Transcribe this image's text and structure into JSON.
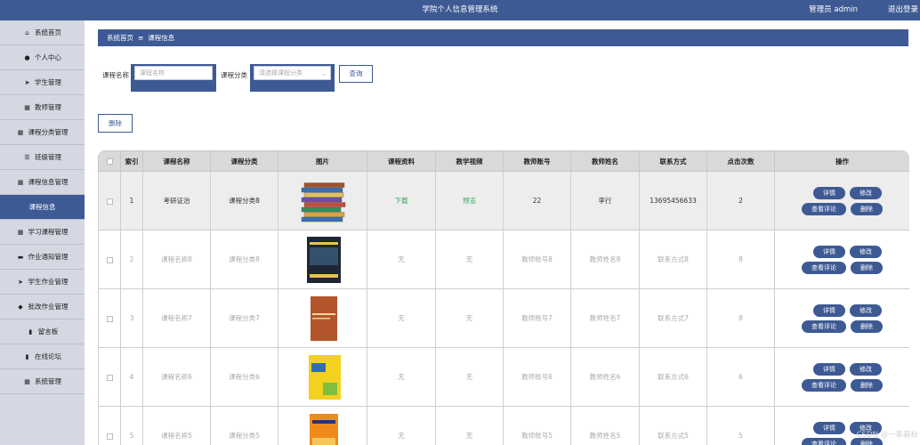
{
  "header": {
    "title": "学院个人信息管理系统",
    "user": "管理员 admin",
    "logout": "退出登录"
  },
  "sidebar": {
    "items": [
      {
        "label": "系统首页",
        "icon": "home-icon",
        "glyph": "⌂"
      },
      {
        "label": "个人中心",
        "icon": "person-icon",
        "glyph": "●"
      },
      {
        "label": "学生管理",
        "icon": "send-icon",
        "glyph": "➤"
      },
      {
        "label": "教师管理",
        "icon": "grid-icon",
        "glyph": "▦"
      },
      {
        "label": "课程分类管理",
        "icon": "grid-icon",
        "glyph": "▦"
      },
      {
        "label": "班级管理",
        "icon": "list-icon",
        "glyph": "☰"
      },
      {
        "label": "课程信息管理",
        "icon": "grid-icon",
        "glyph": "▦"
      },
      {
        "label": "课程信息",
        "icon": "",
        "glyph": ""
      },
      {
        "label": "学习课程管理",
        "icon": "grid-icon",
        "glyph": "▦"
      },
      {
        "label": "作业通知管理",
        "icon": "monitor-icon",
        "glyph": "▬"
      },
      {
        "label": "学生作业管理",
        "icon": "send-icon",
        "glyph": "➤"
      },
      {
        "label": "批改作业管理",
        "icon": "pin-icon",
        "glyph": "◆"
      },
      {
        "label": "留言板",
        "icon": "bookmark-icon",
        "glyph": "▮"
      },
      {
        "label": "在线论坛",
        "icon": "chart-icon",
        "glyph": "▮"
      },
      {
        "label": "系统管理",
        "icon": "grid-icon",
        "glyph": "▦"
      }
    ],
    "active_index": 7
  },
  "breadcrumb": {
    "home": "系统首页",
    "separator": "≡",
    "current": "课程信息"
  },
  "search": {
    "name_label": "课程名称",
    "name_placeholder": "课程名称",
    "category_label": "课程分类",
    "category_placeholder": "请选择课程分类",
    "query_button": "查询"
  },
  "delete_button": "删除",
  "table": {
    "headers": [
      "",
      "索引",
      "课程名称",
      "课程分类",
      "图片",
      "课程资料",
      "教学视频",
      "教师账号",
      "教师姓名",
      "联系方式",
      "点击次数",
      "操作"
    ],
    "rows": [
      {
        "index": "1",
        "name": "考研证治",
        "category": "课程分类8",
        "image": "stack",
        "material": "下载",
        "video": "预览",
        "teacher_account": "22",
        "teacher_name": "李行",
        "contact": "13695456633",
        "clicks": "2"
      },
      {
        "index": "2",
        "name": "课程名称8",
        "category": "课程分类8",
        "image": "dark-book",
        "material": "无",
        "video": "无",
        "teacher_account": "教师账号8",
        "teacher_name": "教师姓名8",
        "contact": "联系方式8",
        "clicks": "8"
      },
      {
        "index": "3",
        "name": "课程名称7",
        "category": "课程分类7",
        "image": "brown-book",
        "material": "无",
        "video": "无",
        "teacher_account": "教师账号7",
        "teacher_name": "教师姓名7",
        "contact": "联系方式7",
        "clicks": "8"
      },
      {
        "index": "4",
        "name": "课程名称6",
        "category": "课程分类6",
        "image": "yellow-book",
        "material": "无",
        "video": "无",
        "teacher_account": "教师账号6",
        "teacher_name": "教师姓名6",
        "contact": "联系方式6",
        "clicks": "6"
      },
      {
        "index": "5",
        "name": "课程名称5",
        "category": "课程分类5",
        "image": "orange-book",
        "material": "无",
        "video": "无",
        "teacher_account": "教师账号5",
        "teacher_name": "教师姓名5",
        "contact": "联系方式5",
        "clicks": "5"
      }
    ],
    "actions": {
      "detail": "详情",
      "edit": "修改",
      "comments": "查看评论",
      "delete": "删除"
    }
  },
  "watermark": "CSDN @一季春秋",
  "colors": {
    "primary": "#3d5a94",
    "sidebar_bg": "#d4d8e2",
    "link_green": "#3aa85e"
  }
}
